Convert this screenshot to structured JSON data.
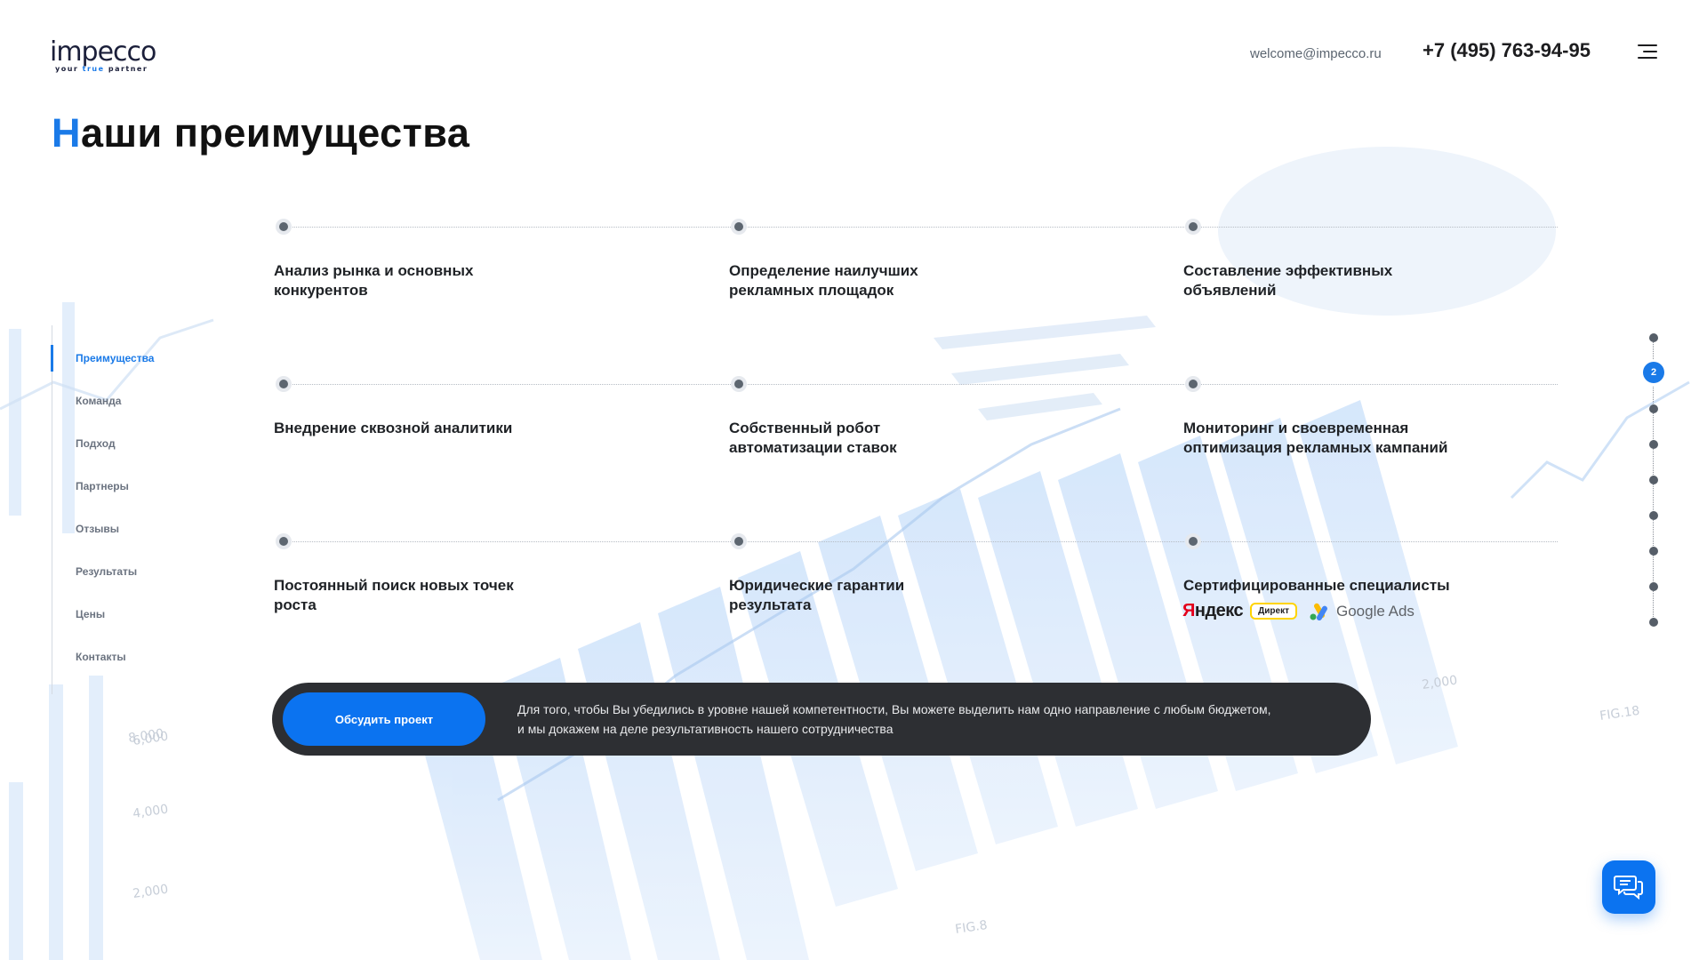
{
  "header": {
    "logo_word": "impecco",
    "logo_tag_1": "your",
    "logo_tag_2": "true",
    "logo_tag_3": "partner",
    "email": "welcome@impecco.ru",
    "phone": "+7 (495) 763-94-95",
    "menu_icon": "hamburger-icon"
  },
  "title": {
    "first_letter": "Н",
    "rest": "аши преимущества"
  },
  "nav": {
    "items": [
      "Преимущества",
      "Команда",
      "Подход",
      "Партнеры",
      "Отзывы",
      "Результаты",
      "Цены",
      "Контакты"
    ],
    "active_index": 0
  },
  "advantages": [
    "Анализ рынка и основных конкурентов",
    "Определение наилучших рекламных площадок",
    "Составление эффективных объявлений",
    "Внедрение сквозной аналитики",
    "Собственный робот автоматизации ставок",
    "Мониторинг и своевременная оптимизация рекламных кампаний",
    "Постоянный поиск новых точек роста",
    "Юридические гарантии результата",
    "Сертифицированные специалисты"
  ],
  "certs": {
    "yandex_y": "Я",
    "yandex_rest": "ндекс",
    "direkt": "Директ",
    "google_ads": "Google Ads"
  },
  "pager": {
    "active_label": "2",
    "count": 9
  },
  "cta": {
    "button": "Обсудить проект",
    "text_line1": "Для того, чтобы Вы убедились в уровне нашей компетентности, Вы можете выделить нам одно направление с любым бюджетом,",
    "text_line2": "и мы докажем на деле результативность нашего сотрудничества"
  },
  "chat": {
    "icon": "chat-bubbles-icon"
  },
  "colors": {
    "accent": "#1a7ae8",
    "button": "#0b73f0",
    "cta_bg": "#2d2f33"
  }
}
